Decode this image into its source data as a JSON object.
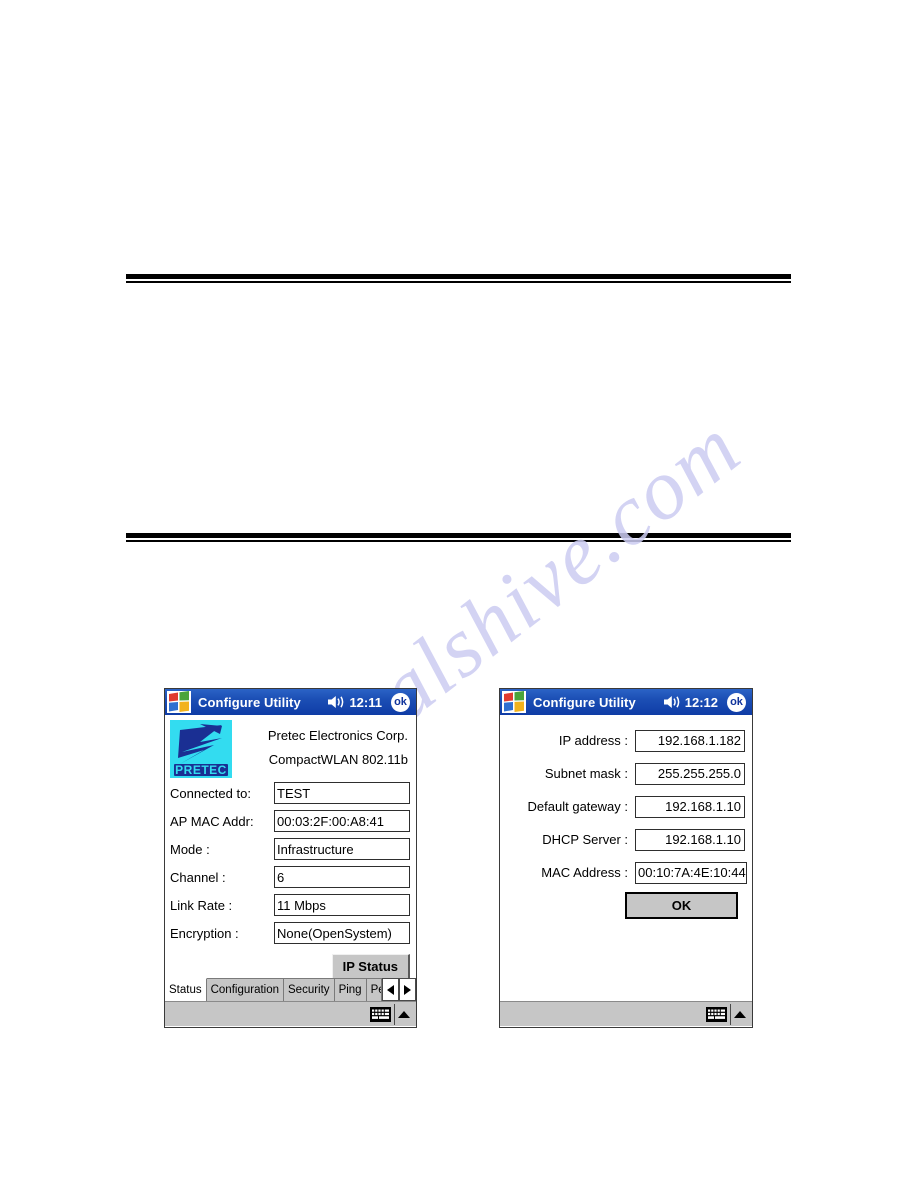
{
  "page": {
    "watermark": "manualshive.com"
  },
  "windows": {
    "status": {
      "titlebar": {
        "title": "Configure Utility",
        "clock": "12:11",
        "ok_label": "ok"
      },
      "brand": {
        "company": "Pretec Electronics Corp.",
        "product": "CompactWLAN 802.11b"
      },
      "fields": [
        {
          "label": "Connected to:",
          "value": "TEST"
        },
        {
          "label": "AP MAC Addr:",
          "value": "00:03:2F:00:A8:41"
        },
        {
          "label": "Mode :",
          "value": "Infrastructure"
        },
        {
          "label": "Channel :",
          "value": "6"
        },
        {
          "label": "Link Rate :",
          "value": "11 Mbps"
        },
        {
          "label": "Encryption :",
          "value": "None(OpenSystem)"
        }
      ],
      "ip_status_button": "IP Status",
      "tabs": [
        {
          "label": "Status",
          "active": true
        },
        {
          "label": "Configuration",
          "active": false
        },
        {
          "label": "Security",
          "active": false
        },
        {
          "label": "Ping",
          "active": false
        },
        {
          "label": "Pe",
          "active": false
        }
      ]
    },
    "ipstatus": {
      "titlebar": {
        "title": "Configure Utility",
        "clock": "12:12",
        "ok_label": "ok"
      },
      "fields": [
        {
          "label": "IP address :",
          "value": "192.168.1.182"
        },
        {
          "label": "Subnet mask :",
          "value": "255.255.255.0"
        },
        {
          "label": "Default gateway :",
          "value": "192.168.1.10"
        },
        {
          "label": "DHCP Server :",
          "value": "192.168.1.10"
        },
        {
          "label": "MAC Address :",
          "value": "00:10:7A:4E:10:44"
        }
      ],
      "ok_button": "OK"
    }
  },
  "colors": {
    "titlebar_blue": "#1c4fb5",
    "chrome_gray": "#c6c6c6",
    "logo_cyan": "#33dcf0",
    "logo_blue": "#1a2f93"
  }
}
